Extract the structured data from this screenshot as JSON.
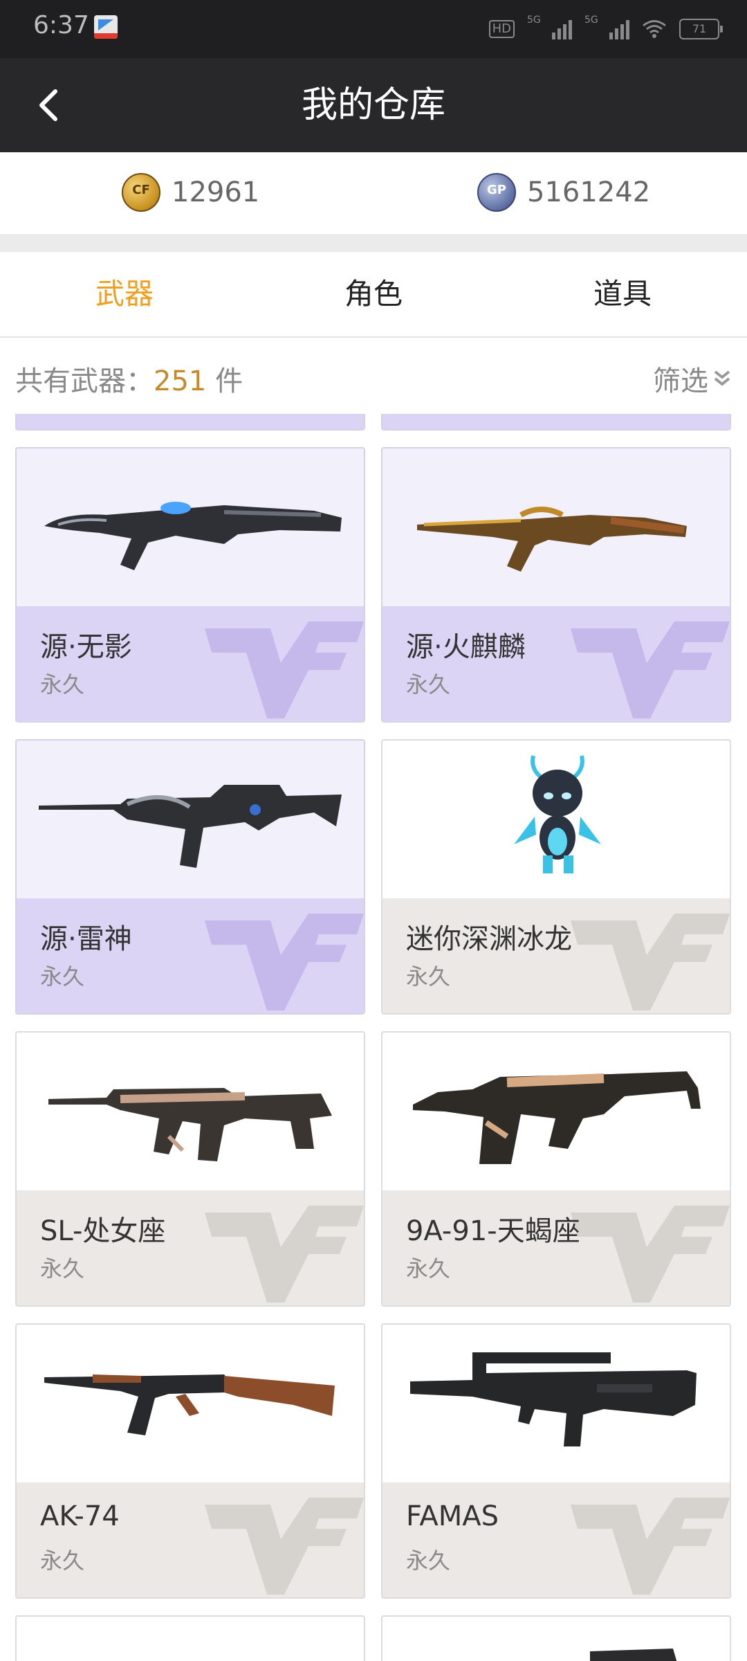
{
  "status_bar": {
    "time": "6:37",
    "network_1": "5G",
    "network_2": "5G",
    "hd": "HD",
    "battery": "71"
  },
  "header": {
    "title": "我的仓库",
    "back_icon": "chevron-left-icon"
  },
  "currency": {
    "cf_points": "12961",
    "gp_points": "5161242"
  },
  "tabs": [
    {
      "label": "武器",
      "active": true
    },
    {
      "label": "角色",
      "active": false
    },
    {
      "label": "道具",
      "active": false
    }
  ],
  "inventory": {
    "count_label": "共有武器：",
    "count": "251",
    "count_unit": " 件",
    "filter_label": "筛选"
  },
  "items": [
    {
      "name": "源·无影",
      "duration": "永久",
      "rarity": "purple",
      "icon": "rifle-ak-blade-icon"
    },
    {
      "name": "源·火麒麟",
      "duration": "永久",
      "rarity": "purple",
      "icon": "rifle-ak-gold-icon"
    },
    {
      "name": "源·雷神",
      "duration": "永久",
      "rarity": "purple",
      "icon": "rifle-m4-icon"
    },
    {
      "name": "迷你深渊冰龙",
      "duration": "永久",
      "rarity": "grey",
      "icon": "mini-dragon-icon"
    },
    {
      "name": "SL-处女座",
      "duration": "永久",
      "rarity": "grey",
      "icon": "rifle-scar-icon"
    },
    {
      "name": "9A-91-天蝎座",
      "duration": "永久",
      "rarity": "grey",
      "icon": "rifle-9a91-icon"
    },
    {
      "name": "AK-74",
      "duration": "永久",
      "rarity": "grey",
      "icon": "rifle-ak74-icon"
    },
    {
      "name": "FAMAS",
      "duration": "永久",
      "rarity": "grey",
      "icon": "rifle-famas-icon"
    }
  ],
  "colors": {
    "tab_active": "#f0a020",
    "count_number": "#c58a2a",
    "purple_card": "#dcd4f4",
    "grey_card": "#ebe8e5",
    "header_bg": "#28282a"
  }
}
